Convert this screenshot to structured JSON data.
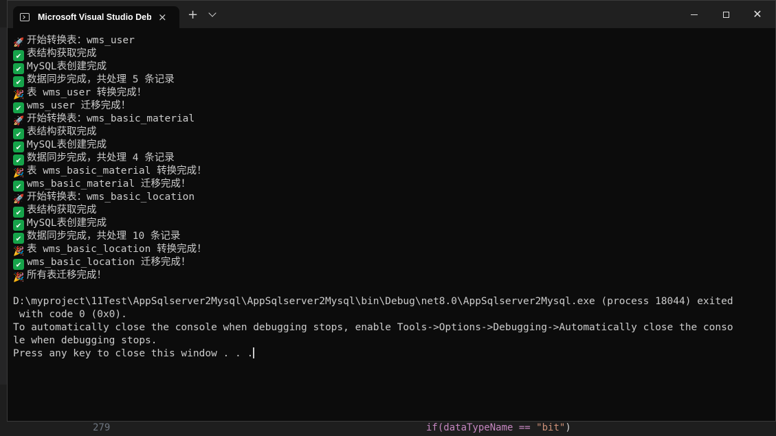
{
  "window": {
    "tab_title": "Microsoft Visual Studio Debug Console",
    "new_tab_label": "+",
    "close_tab_label": "×",
    "close_label": "✕"
  },
  "console": {
    "lines": [
      {
        "icon": "rocket",
        "text": "开始转换表：wms_user"
      },
      {
        "icon": "check",
        "text": "表结构获取完成"
      },
      {
        "icon": "check",
        "text": "MySQL表创建完成"
      },
      {
        "icon": "check",
        "text": "数据同步完成，共处理 5 条记录"
      },
      {
        "icon": "party",
        "text": "表 wms_user 转换完成！"
      },
      {
        "icon": "check",
        "text": "wms_user 迁移完成！"
      },
      {
        "icon": "rocket",
        "text": "开始转换表：wms_basic_material"
      },
      {
        "icon": "check",
        "text": "表结构获取完成"
      },
      {
        "icon": "check",
        "text": "MySQL表创建完成"
      },
      {
        "icon": "check",
        "text": "数据同步完成，共处理 4 条记录"
      },
      {
        "icon": "party",
        "text": "表 wms_basic_material 转换完成！"
      },
      {
        "icon": "check",
        "text": "wms_basic_material 迁移完成！"
      },
      {
        "icon": "rocket",
        "text": "开始转换表：wms_basic_location"
      },
      {
        "icon": "check",
        "text": "表结构获取完成"
      },
      {
        "icon": "check",
        "text": "MySQL表创建完成"
      },
      {
        "icon": "check",
        "text": "数据同步完成，共处理 10 条记录"
      },
      {
        "icon": "party",
        "text": "表 wms_basic_location 转换完成！"
      },
      {
        "icon": "check",
        "text": "wms_basic_location 迁移完成！"
      },
      {
        "icon": "party",
        "text": "所有表迁移完成！"
      },
      {
        "icon": "",
        "text": ""
      },
      {
        "icon": "",
        "text": "D:\\myproject\\11Test\\AppSqlserver2Mysql\\AppSqlserver2Mysql\\bin\\Debug\\net8.0\\AppSqlserver2Mysql.exe (process 18044) exited"
      },
      {
        "icon": "",
        "text": " with code 0 (0x0)."
      },
      {
        "icon": "",
        "text": "To automatically close the console when debugging stops, enable Tools->Options->Debugging->Automatically close the conso"
      },
      {
        "icon": "",
        "text": "le when debugging stops."
      },
      {
        "icon": "",
        "text": "Press any key to close this window . . ."
      }
    ]
  },
  "background_editor": {
    "line_number": "279",
    "code_prefix": "if(dataTypeName == ",
    "code_string": "\"bit\"",
    "code_suffix": ")"
  }
}
